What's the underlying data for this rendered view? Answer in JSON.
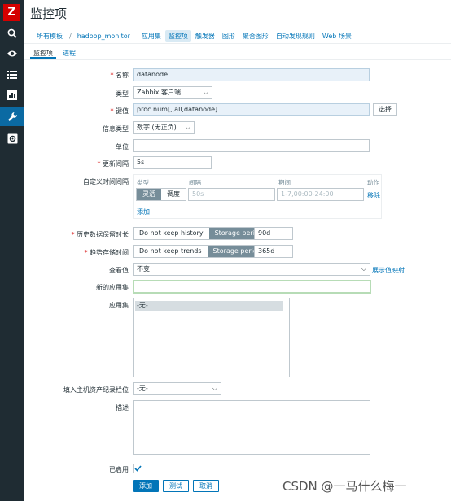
{
  "app": {
    "logo_letter": "Z",
    "page_title": "监控项"
  },
  "sidebar": {
    "items": [
      {
        "icon": "search-icon"
      },
      {
        "icon": "eye-icon"
      },
      {
        "icon": "list-icon"
      },
      {
        "icon": "bar-chart-icon"
      },
      {
        "icon": "wrench-icon"
      },
      {
        "icon": "gear-icon"
      }
    ]
  },
  "breadcrumb": {
    "all_templates": "所有模板",
    "separator": "/",
    "template": "hadoop_monitor",
    "items": [
      "应用集",
      "监控项",
      "触发器",
      "图形",
      "聚合图形",
      "自动发现规则",
      "Web 场景"
    ]
  },
  "tabs": [
    "监控项",
    "进程"
  ],
  "form": {
    "name_label": "名称",
    "name_value": "datanode",
    "type_label": "类型",
    "type_value": "Zabbix 客户端",
    "key_label": "键值",
    "key_value": "proc.num[,,all,datanode]",
    "select_button": "选择",
    "info_type_label": "信息类型",
    "info_type_value": "数字 (无正负)",
    "unit_label": "单位",
    "unit_value": "",
    "interval_label": "更新间隔",
    "interval_value": "5s",
    "custom_interval_label": "自定义时间间隔",
    "custom_table": {
      "col_type": "类型",
      "col_interval": "间隔",
      "col_period": "期间",
      "col_action": "动作",
      "seg_flexible": "灵活",
      "seg_scheduling": "调度",
      "interval_placeholder": "50s",
      "period_placeholder": "1-7,00:00-24:00",
      "remove": "移除",
      "add": "添加"
    },
    "history_label": "历史数据保留时长",
    "history_opt_off": "Do not keep history",
    "history_opt_on": "Storage period",
    "history_value": "90d",
    "trends_label": "趋势存储时间",
    "trends_opt_off": "Do not keep trends",
    "trends_opt_on": "Storage period",
    "trends_value": "365d",
    "valuemap_label": "查看值",
    "valuemap_value": "不变",
    "valuemap_link": "展示值映射",
    "new_app_label": "新的应用集",
    "new_app_value": "",
    "apps_label": "应用集",
    "apps_option": "-无-",
    "inventory_label": "填入主机资产纪录栏位",
    "inventory_value": "-无-",
    "desc_label": "描述",
    "enabled_label": "已启用",
    "add_button": "添加",
    "test_button": "测试",
    "cancel_button": "取消"
  },
  "watermark": "CSDN @一马什么梅一",
  "colors": {
    "sidebar": "#1f2c33",
    "accent": "#0275b8",
    "logo": "#d40000",
    "active_nav": "#0b6aa3"
  }
}
